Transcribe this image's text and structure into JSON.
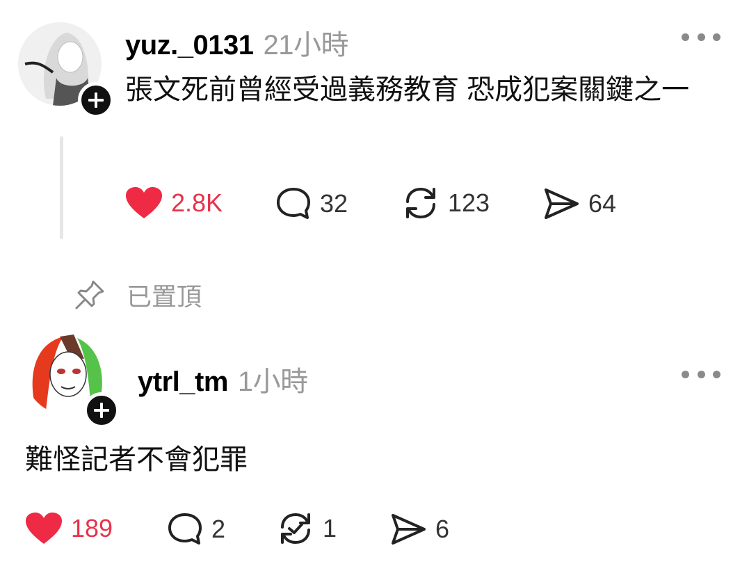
{
  "post1": {
    "username": "yuz._0131",
    "time": "21小時",
    "text": "張文死前曾經受過義務教育 恐成犯案關鍵之一",
    "likes": "2.8K",
    "comments": "32",
    "reposts": "123",
    "shares": "64",
    "liked": true
  },
  "pinned": {
    "label": "已置頂"
  },
  "post2": {
    "username": "ytrl_tm",
    "time": "1小時",
    "text": "難怪記者不會犯罪",
    "likes": "189",
    "comments": "2",
    "reposts": "1",
    "shares": "6",
    "liked": true
  },
  "colors": {
    "like": "#e8324a",
    "muted": "#999999"
  },
  "icons": [
    "heart-icon",
    "comment-icon",
    "repost-icon",
    "share-icon",
    "pin-icon",
    "plus-icon",
    "more-icon"
  ]
}
